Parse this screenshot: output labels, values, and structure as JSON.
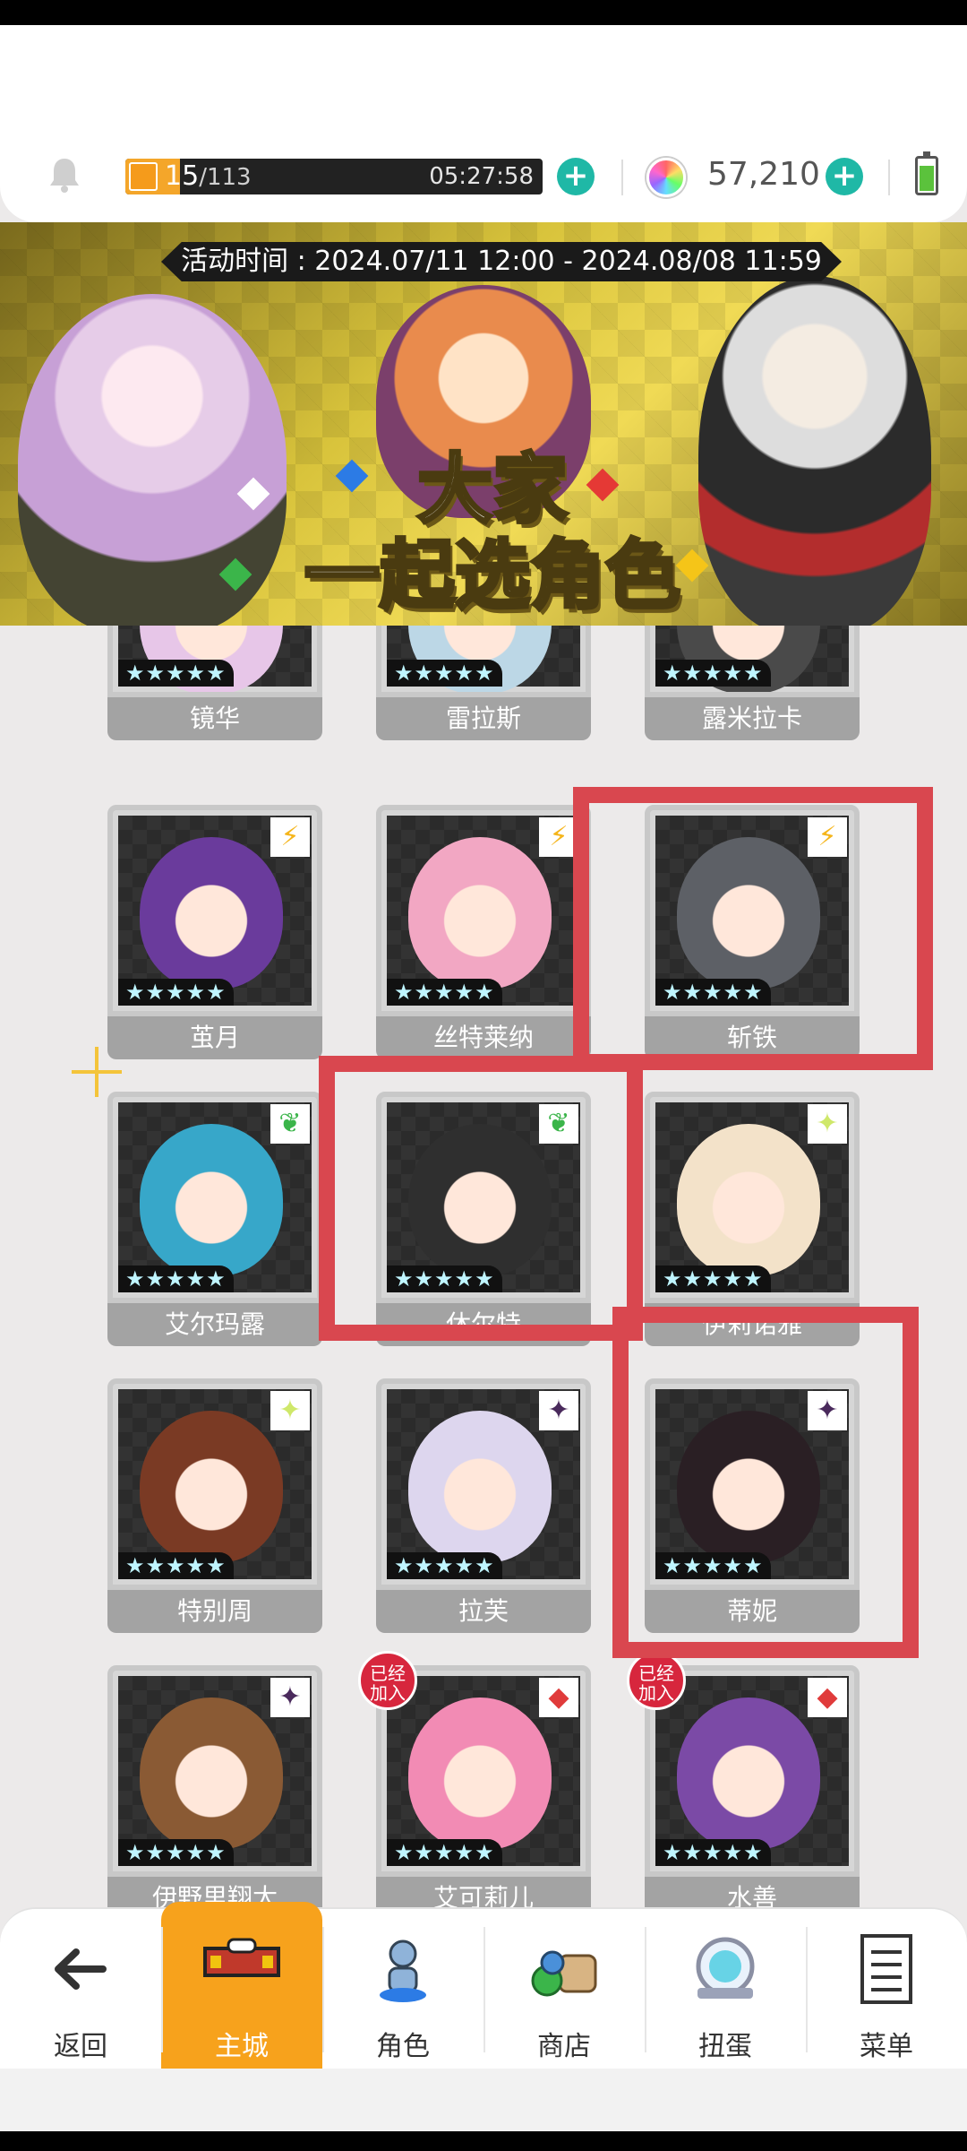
{
  "status": {
    "stamina_current": "15",
    "stamina_max": "/113",
    "stamina_fraction": 0.13,
    "timer": "05:27:58",
    "gems": "57,210"
  },
  "banner": {
    "event_time": "活动时间 : 2024.07/11 12:00 - 2024.08/08 11:59",
    "title_line1": "大家",
    "title_line2": "一起选角色"
  },
  "characters": [
    {
      "name": "镜华",
      "stars": "★★★★★",
      "attr": "",
      "attr_color": "#a35bd6",
      "color": "#e7c6e8"
    },
    {
      "name": "雷拉斯",
      "stars": "★★★★★",
      "attr": "",
      "attr_color": "#2aa34a",
      "color": "#bcd7e6"
    },
    {
      "name": "露米拉卡",
      "stars": "★★★★★",
      "attr": "",
      "attr_color": "#333",
      "color": "#4a4a4a"
    },
    {
      "name": "茧月",
      "stars": "★★★★★",
      "attr": "⚡",
      "attr_color": "#f5b51b",
      "color": "#6a3b9c"
    },
    {
      "name": "丝特莱纳",
      "stars": "★★★★★",
      "attr": "⚡",
      "attr_color": "#f5b51b",
      "color": "#f2a7c3"
    },
    {
      "name": "斩铁",
      "stars": "★★★★★",
      "attr": "⚡",
      "attr_color": "#f5b51b",
      "color": "#5d6066"
    },
    {
      "name": "艾尔玛露",
      "stars": "★★★★★",
      "attr": "❦",
      "attr_color": "#3bb54a",
      "color": "#37a7c9"
    },
    {
      "name": "休尔特",
      "stars": "★★★★★",
      "attr": "❦",
      "attr_color": "#3bb54a",
      "color": "#2f2f2f"
    },
    {
      "name": "伊莉诺雅",
      "stars": "★★★★★",
      "attr": "✦",
      "attr_color": "#cfe86a",
      "color": "#f3e2c9"
    },
    {
      "name": "特别周",
      "stars": "★★★★★",
      "attr": "✦",
      "attr_color": "#cfe86a",
      "color": "#7a3a24"
    },
    {
      "name": "拉芙",
      "stars": "★★★★★",
      "attr": "✦",
      "attr_color": "#4a2a5c",
      "color": "#ddd6ee"
    },
    {
      "name": "蒂妮",
      "stars": "★★★★★",
      "attr": "✦",
      "attr_color": "#4a2a5c",
      "color": "#2a1f24"
    },
    {
      "name": "伊野里翔太",
      "stars": "★★★★★",
      "attr": "✦",
      "attr_color": "#4a2a5c",
      "color": "#8a5a34"
    },
    {
      "name": "艾可莉儿",
      "stars": "★★★★★",
      "attr": "◆",
      "attr_color": "#e03b3b",
      "color": "#f28bb4",
      "joined": "已经\n加入"
    },
    {
      "name": "水善",
      "stars": "★★★★★",
      "attr": "◆",
      "attr_color": "#e03b3b",
      "color": "#7b4aa6",
      "joined": "已经\n加入"
    }
  ],
  "nav": [
    {
      "label": "返回",
      "icon": "back-arrow-icon"
    },
    {
      "label": "主城",
      "icon": "castle-icon",
      "active": true
    },
    {
      "label": "角色",
      "icon": "character-icon"
    },
    {
      "label": "商店",
      "icon": "shop-icon"
    },
    {
      "label": "扭蛋",
      "icon": "gacha-icon"
    },
    {
      "label": "菜单",
      "icon": "menu-icon"
    }
  ]
}
